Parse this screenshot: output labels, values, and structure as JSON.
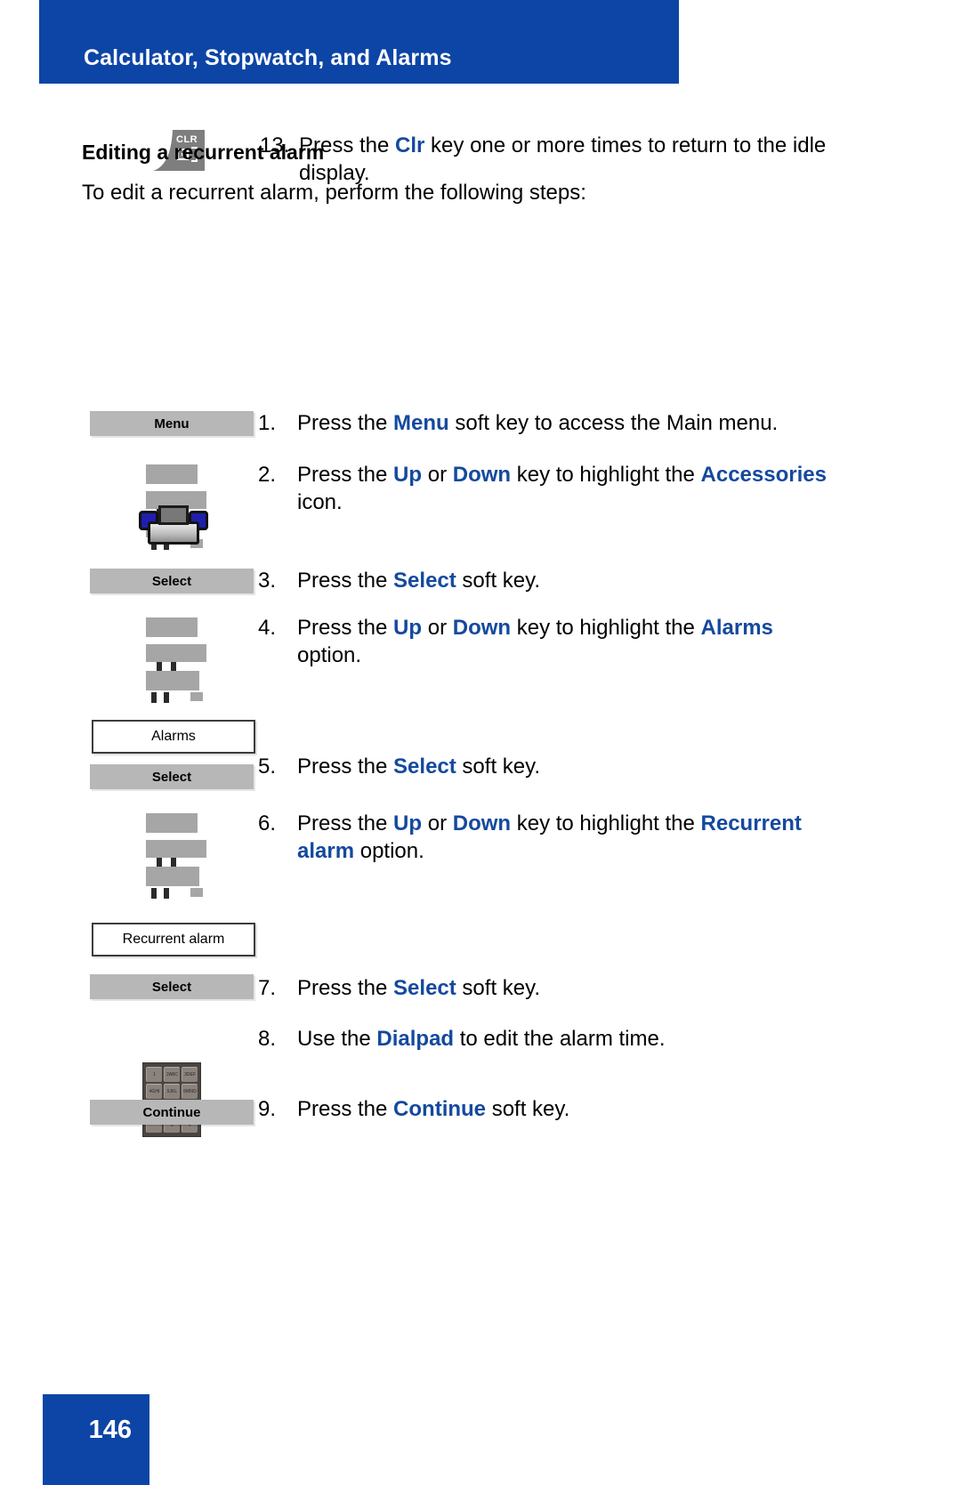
{
  "header": {
    "title": "Calculator, Stopwatch, and Alarms"
  },
  "section": {
    "heading": "Editing a recurrent alarm",
    "intro": "To edit a recurrent alarm, perform the following steps:"
  },
  "top_step": {
    "number": "13.",
    "icon": "clr-key-icon",
    "icon_label": "CLR",
    "text_before": "Press the ",
    "keyword": "Clr",
    "text_after": " key one or more times to return to the idle display."
  },
  "steps": [
    {
      "number": "1.",
      "icon": "softkey-menu-icon",
      "icon_label": "Menu",
      "segments": [
        {
          "t": "Press the ",
          "kw": false
        },
        {
          "t": "Menu",
          "kw": true
        },
        {
          "t": " soft key to access the Main menu.",
          "kw": false
        }
      ]
    },
    {
      "number": "2.",
      "icon": "navigation-key-icon",
      "icon_label": "",
      "segments": [
        {
          "t": "Press the ",
          "kw": false
        },
        {
          "t": "Up",
          "kw": true
        },
        {
          "t": " or ",
          "kw": false
        },
        {
          "t": "Down",
          "kw": true
        },
        {
          "t": " key to highlight the ",
          "kw": false
        },
        {
          "t": "Accessories",
          "kw": true
        },
        {
          "t": " icon.",
          "kw": false
        }
      ]
    },
    {
      "number": "3.",
      "icon": "softkey-select-icon",
      "icon_label": "Select",
      "segments": [
        {
          "t": "Press the ",
          "kw": false
        },
        {
          "t": "Select",
          "kw": true
        },
        {
          "t": " soft key.",
          "kw": false
        }
      ]
    },
    {
      "number": "4.",
      "icon": "navigation-key-icon",
      "icon_label": "",
      "segments": [
        {
          "t": "Press the ",
          "kw": false
        },
        {
          "t": "Up",
          "kw": true
        },
        {
          "t": " or ",
          "kw": false
        },
        {
          "t": "Down",
          "kw": true
        },
        {
          "t": " key to highlight the ",
          "kw": false
        },
        {
          "t": "Alarms",
          "kw": true
        },
        {
          "t": " option.",
          "kw": false
        }
      ]
    },
    {
      "number": "5.",
      "icon": "softkey-select-icon",
      "icon_label": "Select",
      "segments": [
        {
          "t": "Press the ",
          "kw": false
        },
        {
          "t": "Select",
          "kw": true
        },
        {
          "t": " soft key.",
          "kw": false
        }
      ]
    },
    {
      "number": "6.",
      "icon": "navigation-key-icon",
      "icon_label": "",
      "segments": [
        {
          "t": "Press the ",
          "kw": false
        },
        {
          "t": "Up",
          "kw": true
        },
        {
          "t": " or ",
          "kw": false
        },
        {
          "t": "Down",
          "kw": true
        },
        {
          "t": " key to highlight the ",
          "kw": false
        },
        {
          "t": "Recurrent alarm",
          "kw": true
        },
        {
          "t": " option.",
          "kw": false
        }
      ]
    },
    {
      "number": "7.",
      "icon": "softkey-select-icon",
      "icon_label": "Select",
      "segments": [
        {
          "t": "Press the ",
          "kw": false
        },
        {
          "t": "Select",
          "kw": true
        },
        {
          "t": " soft key.",
          "kw": false
        }
      ]
    },
    {
      "number": "8.",
      "icon": "dialpad-icon",
      "icon_label": "",
      "segments": [
        {
          "t": "Use the ",
          "kw": false
        },
        {
          "t": "Dialpad",
          "kw": true
        },
        {
          "t": " to edit the alarm time.",
          "kw": false
        }
      ]
    },
    {
      "number": "9.",
      "icon": "softkey-continue-icon",
      "icon_label": "Continue",
      "segments": [
        {
          "t": "Press the ",
          "kw": false
        },
        {
          "t": "Continue",
          "kw": true
        },
        {
          "t": " soft key.",
          "kw": false
        }
      ]
    }
  ],
  "option_boxes": {
    "alarms": "Alarms",
    "recurrent_alarm": "Recurrent alarm"
  },
  "softkeys": {
    "menu": "Menu",
    "select": "Select",
    "continue": "Continue"
  },
  "dialpad_keys": [
    "1",
    "2ABC",
    "3DEF",
    "4GHI",
    "5JKL",
    "6MNO",
    "7PQRS",
    "8TUV",
    "9WXYZ",
    "*",
    "0",
    "#"
  ],
  "footer": {
    "page_number": "146"
  },
  "colors": {
    "brand_blue": "#0c45a6",
    "keyword_blue": "#14499e",
    "softkey_grey": "#b7b7b7"
  }
}
